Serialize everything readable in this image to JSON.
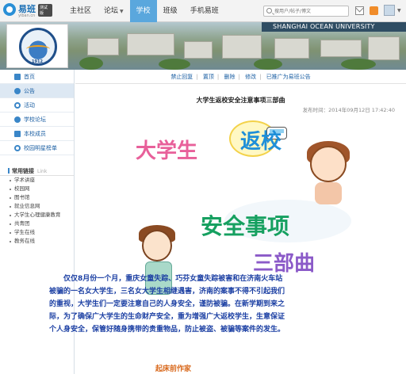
{
  "logo": {
    "name": "易班",
    "beta_badge": "测试版",
    "domain": "yiban.cn"
  },
  "nav": {
    "items": [
      {
        "label": "主社区",
        "active": false,
        "dropdown": false
      },
      {
        "label": "论坛",
        "active": false,
        "dropdown": true
      },
      {
        "label": "学校",
        "active": true,
        "dropdown": false
      },
      {
        "label": "班级",
        "active": false,
        "dropdown": false
      },
      {
        "label": "手机易班",
        "active": false,
        "dropdown": false
      }
    ]
  },
  "search": {
    "placeholder": "搜用户/帖子/博文"
  },
  "banner": {
    "university_en": "SHANGHAI OCEAN UNIVERSITY",
    "logo_year": "1912"
  },
  "sidebar": {
    "items": [
      {
        "label": "首页",
        "active": false
      },
      {
        "label": "公告",
        "active": true
      },
      {
        "label": "活动",
        "active": false
      },
      {
        "label": "学校论坛",
        "active": false
      },
      {
        "label": "本校成员",
        "active": false
      },
      {
        "label": "校园明星榜单",
        "active": false
      }
    ],
    "links_title": "常用链接",
    "links_title_en": "Link",
    "links": [
      "学术讲座",
      "校园网",
      "图书馆",
      "就业信息网",
      "大学生心理健康教育",
      "共青团",
      "学生在线",
      "教务在线"
    ]
  },
  "toolbar": {
    "items": [
      "禁止回复",
      "置顶",
      "删除",
      "修改",
      "已推广为易班公告"
    ]
  },
  "article": {
    "title": "大学生返校安全注意事项三部曲",
    "pub_time": "发布时间：2014年09月12日  17:42:40",
    "poster_line1": "大学生",
    "poster_line2": "返校",
    "poster_line3": "安全事项",
    "poster_line4": "三部曲",
    "body": "仅仅8月份一个月，重庆女童失踪、巧芬女童失踪被害和在济南火车站被骗的一名女大学生，三名女大学生相继遇害，济南的案事不得不引起我们的重视，大学生们一定要注意自己的人身安全，谨防被骗。在新学期到来之际，为了确保广大学生的生命财产安全，重为增强广大返校学生，生意保证个人身安全，保管好随身携带的贵重物品，防止被盗、被骗等案件的发生。",
    "next_heading": "起床前作家"
  },
  "colors": {
    "nav_active": "#5aa7dd",
    "link": "#1b5fa3",
    "sidebar_active": "#dde8f3"
  }
}
